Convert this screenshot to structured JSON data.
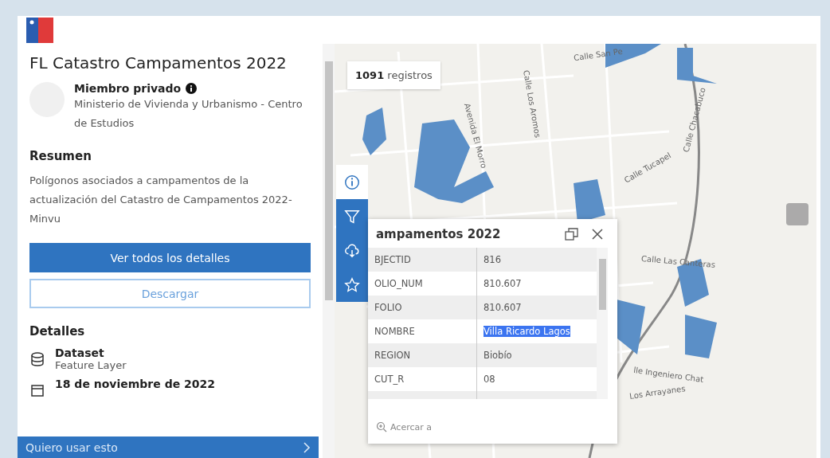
{
  "panel": {
    "title": "FL Catastro Campamentos 2022",
    "owner": "Miembro privado",
    "organization": "Ministerio de Vivienda y Urbanismo - Centro de Estudios",
    "summary_heading": "Resumen",
    "summary": "Polígonos asociados a campamentos de la actualización del Catastro de Campamentos 2022- Minvu",
    "buttons": [
      {
        "label": "Ver todos los detalles",
        "kind": "primary"
      },
      {
        "label": "Descargar",
        "kind": "secondary"
      }
    ],
    "details_heading": "Detalles",
    "details": [
      {
        "kind": "dataset",
        "title": "Dataset",
        "subtitle": "Feature Layer"
      },
      {
        "kind": "date",
        "title": "18 de noviembre de 2022"
      }
    ],
    "bottom_bar": "Quiero usar esto"
  },
  "map": {
    "record_count": "**1091** registros",
    "street_labels": [
      {
        "text": "Calle San Pe"
      },
      {
        "text": "Calle Los Aromos"
      },
      {
        "text": "Avenida El Morro"
      },
      {
        "text": "Calle Tucapel"
      },
      {
        "text": "Calle Chacabuco"
      },
      {
        "text": "Calle Las Canteras"
      },
      {
        "text": "lle Ingeniero Chat"
      },
      {
        "text": "Los Arrayanes"
      }
    ],
    "toolbar": [
      {
        "kind": "info",
        "selected": true
      },
      {
        "kind": "filter",
        "selected": false
      },
      {
        "kind": "download",
        "selected": false
      },
      {
        "kind": "favorite",
        "selected": false
      }
    ],
    "popup": {
      "title": "ampamentos 2022",
      "rows": [
        {
          "field": "BJECTID",
          "value": "816",
          "highlighted": false
        },
        {
          "field": "OLIO_NUM",
          "value": "810.607",
          "highlighted": false
        },
        {
          "field": "FOLIO",
          "value": "810.607",
          "highlighted": false
        },
        {
          "field": "NOMBRE",
          "value": "Villa Ricardo Lagos",
          "highlighted": true
        },
        {
          "field": "REGION",
          "value": "Biobío",
          "highlighted": false
        },
        {
          "field": "CUT_R",
          "value": "08",
          "highlighted": false
        }
      ],
      "zoom_action": "Acercar a"
    }
  }
}
